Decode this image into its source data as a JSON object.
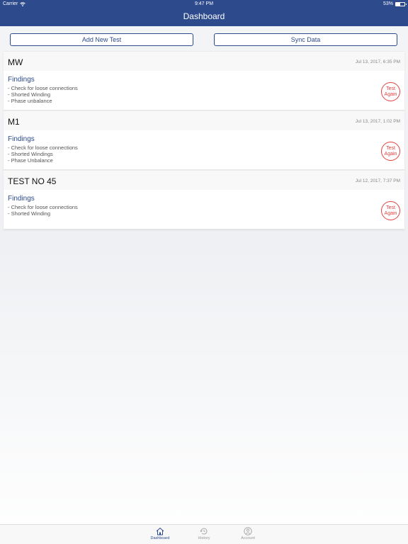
{
  "status": {
    "carrier": "Carrier",
    "time": "9:47 PM",
    "battery": "53%",
    "battery_level": 0.53
  },
  "header": {
    "title": "Dashboard"
  },
  "actions": {
    "add_label": "Add New Test",
    "sync_label": "Sync Data"
  },
  "findings_label": "Findings",
  "retest_label_1": "Test",
  "retest_label_2": "Again",
  "tests": [
    {
      "name": "MW",
      "date": "Jul 13, 2017, 6:35 PM",
      "findings": [
        "- Check for loose connections",
        "- Shorted Winding",
        "- Phase unbalance"
      ]
    },
    {
      "name": "M1",
      "date": "Jul 13, 2017, 1:02 PM",
      "findings": [
        "- Check for loose connections",
        "- Shorted Windings",
        "- Phase Unbalance"
      ]
    },
    {
      "name": "TEST NO 45",
      "date": "Jul 12, 2017, 7:37 PM",
      "findings": [
        "- Check for loose connections",
        "- Shorted Winding"
      ]
    }
  ],
  "tabs": {
    "dashboard": "Dashboard",
    "history": "History",
    "account": "Account"
  },
  "colors": {
    "brand": "#2c4a8c",
    "retest": "#e24040"
  },
  "icons": {
    "wifi": "wifi-icon",
    "battery": "battery-icon",
    "home": "home-icon",
    "history": "history-icon",
    "account": "account-icon"
  }
}
